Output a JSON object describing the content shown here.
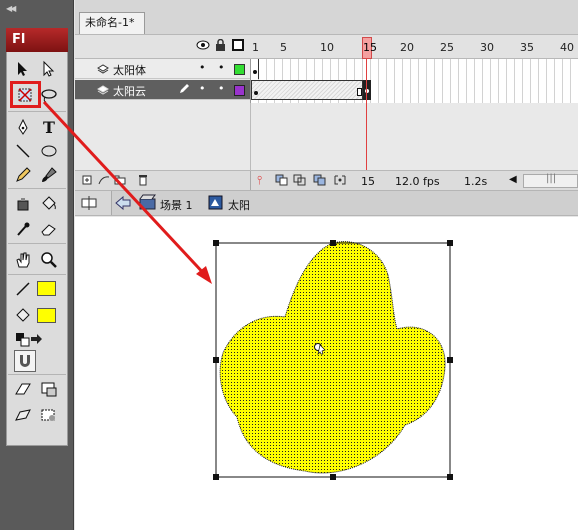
{
  "app": {
    "logo": "Fl"
  },
  "document": {
    "tab_title": "未命名-1*"
  },
  "timeline": {
    "frame_numbers": [
      "1",
      "5",
      "10",
      "15",
      "20",
      "25",
      "30",
      "35",
      "40"
    ],
    "playhead_frame": "15",
    "layers": [
      {
        "name": "太阳体",
        "color": "#33dd33"
      },
      {
        "name": "太阳云",
        "color": "#9933cc"
      }
    ],
    "footer": {
      "current_frame": "15",
      "fps": "12.0 fps",
      "time": "1.2s"
    }
  },
  "editbar": {
    "scene": "场景 1",
    "symbol": "太阳"
  },
  "tools": {
    "stroke_color": "#ffff00",
    "fill_color": "#ffff00",
    "highlighted_tool": "free-transform-tool"
  },
  "stage": {
    "shape_color": "#ffff00"
  },
  "colors": {
    "accent": "#e01c1c",
    "playhead": "#e04040"
  }
}
